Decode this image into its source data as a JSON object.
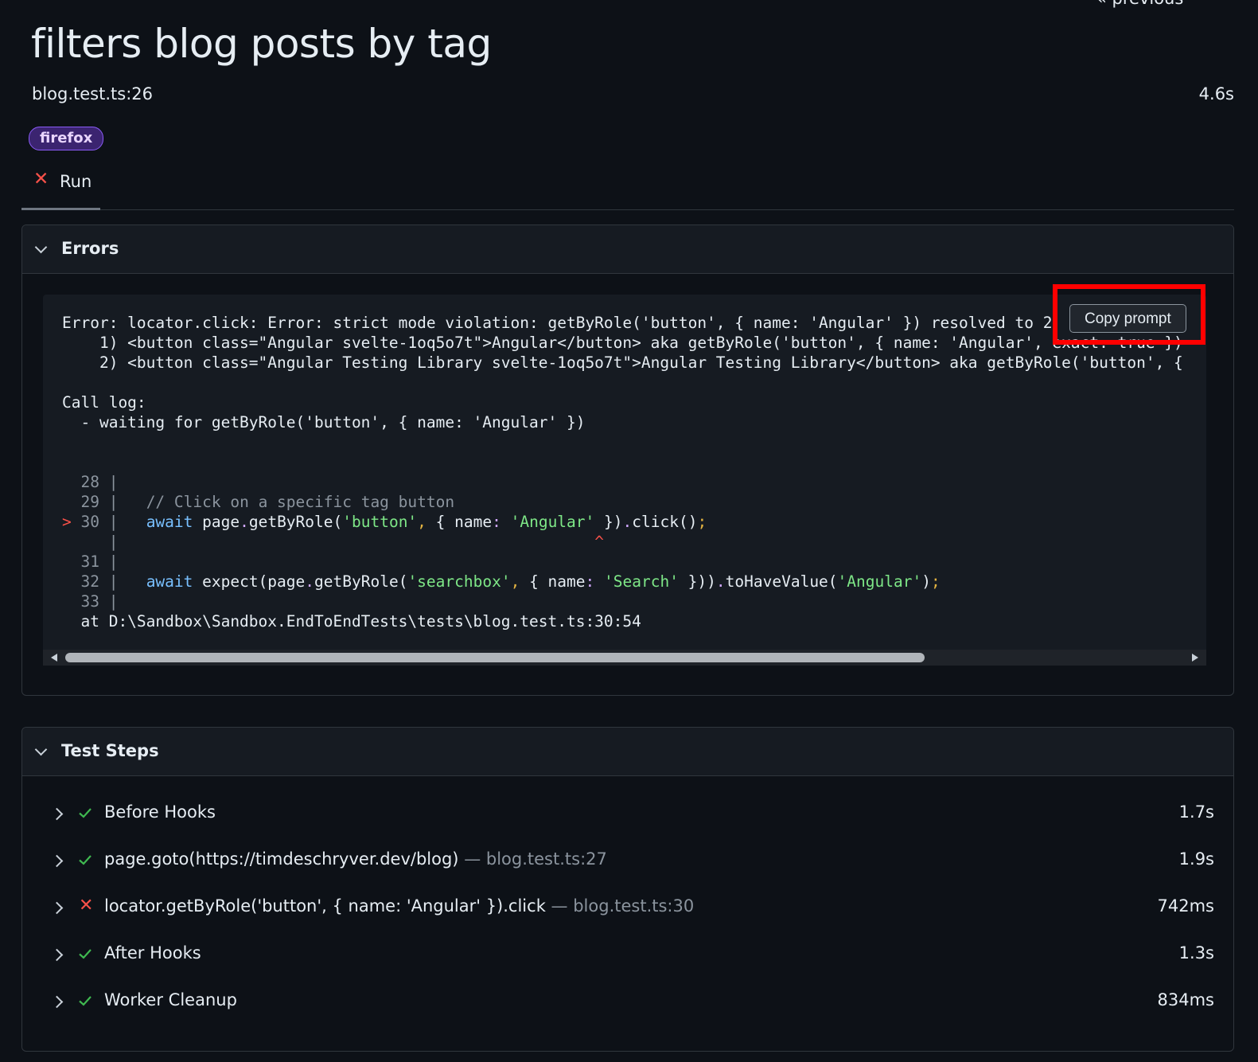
{
  "nav": {
    "previous": "« previous"
  },
  "header": {
    "title": "filters blog posts by tag",
    "location": "blog.test.ts:26",
    "duration": "4.6s",
    "project_badge": "firefox"
  },
  "tabs": [
    {
      "label": "Run",
      "status": "failed",
      "icon": "x-icon"
    }
  ],
  "errors": {
    "title": "Errors",
    "copy_button": "Copy prompt",
    "message_lines": [
      "Error: locator.click: Error: strict mode violation: getByRole('button', { name: 'Angular' }) resolved to 2",
      "    1) <button class=\"Angular svelte-1oq5o7t\">Angular</button> aka getByRole('button', { name: 'Angular', exact: true })",
      "    2) <button class=\"Angular Testing Library svelte-1oq5o7t\">Angular Testing Library</button> aka getByRole('button', {"
    ],
    "call_log_title": "Call log:",
    "call_log_lines": [
      "  - waiting for getByRole('button', { name: 'Angular' })"
    ],
    "at_line": "  at D:\\Sandbox\\Sandbox.EndToEndTests\\tests\\blog.test.ts:30:54"
  },
  "test_steps": {
    "title": "Test Steps",
    "items": [
      {
        "title": "Before Hooks",
        "location": "",
        "duration": "1.7s",
        "status": "passed"
      },
      {
        "title": "page.goto(https://timdeschryver.dev/blog)",
        "location": "— blog.test.ts:27",
        "duration": "1.9s",
        "status": "passed"
      },
      {
        "title": "locator.getByRole('button', { name: 'Angular' }).click",
        "location": "— blog.test.ts:30",
        "duration": "742ms",
        "status": "failed"
      },
      {
        "title": "After Hooks",
        "location": "",
        "duration": "1.3s",
        "status": "passed"
      },
      {
        "title": "Worker Cleanup",
        "location": "",
        "duration": "834ms",
        "status": "passed"
      }
    ]
  },
  "colors": {
    "background": "#0d1117",
    "panel_header": "#161b22",
    "pass": "#3fb950",
    "fail": "#f85149",
    "highlight": "#ff0000"
  }
}
